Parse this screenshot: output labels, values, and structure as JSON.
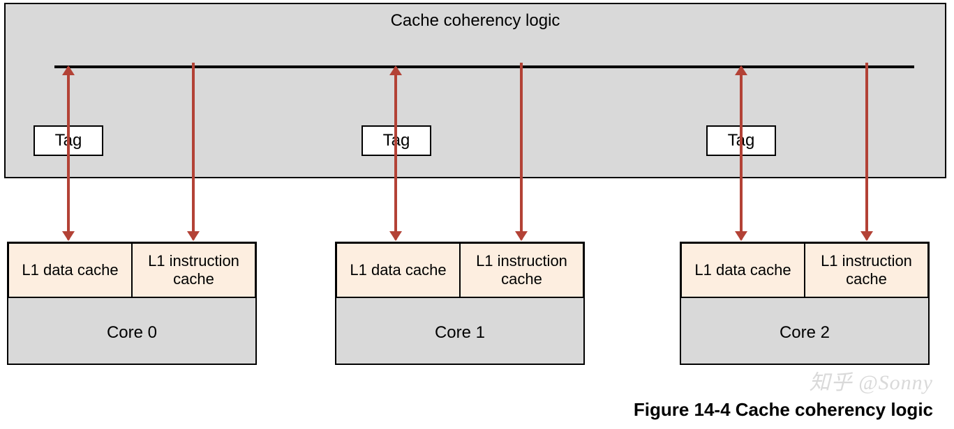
{
  "title": "Cache coherency logic",
  "tag_label": "Tag",
  "cores": [
    {
      "name": "Core 0",
      "l1d": "L1 data cache",
      "l1i": "L1 instruction cache"
    },
    {
      "name": "Core 1",
      "l1d": "L1 data cache",
      "l1i": "L1 instruction cache"
    },
    {
      "name": "Core 2",
      "l1d": "L1 data cache",
      "l1i": "L1 instruction cache"
    }
  ],
  "caption": "Figure 14-4 Cache coherency logic",
  "watermark": "知乎 @Sonny",
  "colors": {
    "arrow": "#b34236",
    "block_bg": "#d9d9d9",
    "cache_bg": "#fdeee0"
  }
}
